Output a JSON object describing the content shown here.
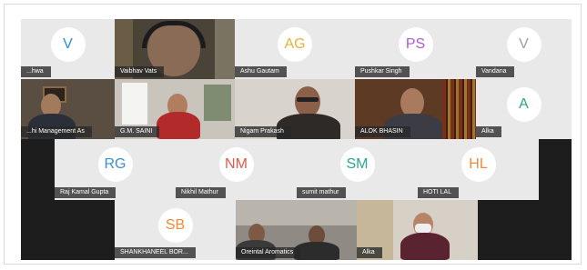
{
  "participants": [
    {
      "name": "...hwa",
      "initials": "V",
      "color": "#2b8fd6"
    },
    {
      "name": "Vaibhav Vats",
      "initials": "",
      "color": "#ffffff"
    },
    {
      "name": "Ashu Gautam",
      "initials": "AG",
      "color": "#e8b33a"
    },
    {
      "name": "Pushkar Singh",
      "initials": "PS",
      "color": "#b05ad6"
    },
    {
      "name": "Vandana",
      "initials": "V",
      "color": "#9aa0a6"
    },
    {
      "name": "...hi Management As",
      "initials": "",
      "color": "#ffffff"
    },
    {
      "name": "G.M. SAINI",
      "initials": "",
      "color": "#ffffff"
    },
    {
      "name": "Nigam Prakash",
      "initials": "",
      "color": "#ffffff"
    },
    {
      "name": "ALOK BHASIN",
      "initials": "",
      "color": "#ffffff"
    },
    {
      "name": "Alka",
      "initials": "A",
      "color": "#2aa58e"
    },
    {
      "name": "Raj Kamal Gupta",
      "initials": "RG",
      "color": "#3a8fd6"
    },
    {
      "name": "Nikhil Mathur",
      "initials": "NM",
      "color": "#e05a4a"
    },
    {
      "name": "sumit mathur",
      "initials": "SM",
      "color": "#2aa58e"
    },
    {
      "name": "HOTI LAL",
      "initials": "HL",
      "color": "#f08a3c"
    },
    {
      "name": "SHANKHANEEL BOR...",
      "initials": "SB",
      "color": "#f08a3c"
    },
    {
      "name": "Orеintal Aromatics",
      "initials": "",
      "color": "#ffffff"
    },
    {
      "name": "Alka",
      "initials": "",
      "color": "#ffffff"
    }
  ]
}
